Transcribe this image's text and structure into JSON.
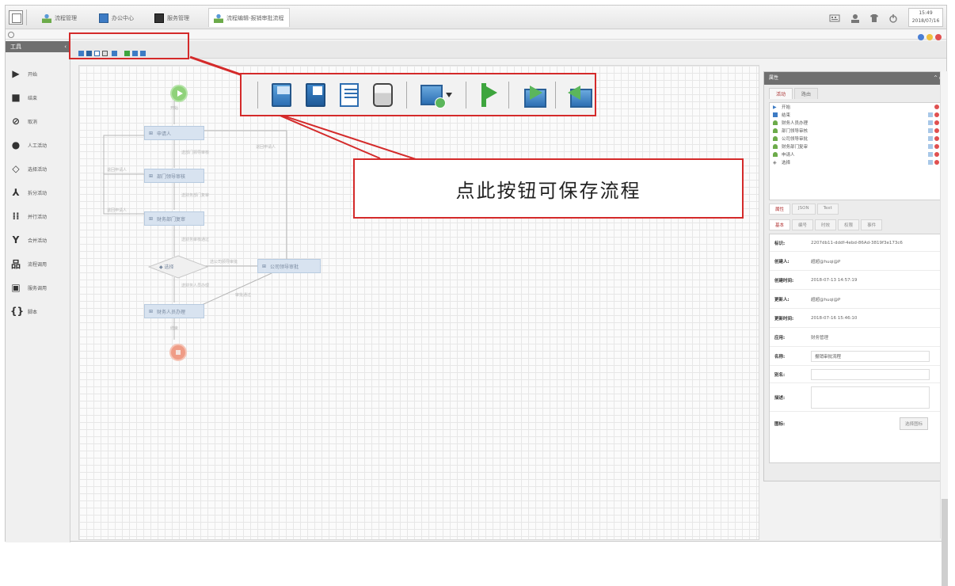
{
  "topbar": {
    "tabs": [
      {
        "label": "流程管理",
        "icon": "user-group-icon"
      },
      {
        "label": "办公中心",
        "icon": "document-icon"
      },
      {
        "label": "服务管理",
        "icon": "monitor-icon"
      },
      {
        "label": "流程编辑-报销审批流程",
        "icon": "user-group-icon"
      }
    ],
    "clock": {
      "time": "15:49",
      "date": "2018/07/16"
    }
  },
  "sidebar": {
    "title": "工具",
    "items": [
      {
        "label": "开始",
        "icon": "play-icon"
      },
      {
        "label": "结束",
        "icon": "stop-icon"
      },
      {
        "label": "取消",
        "icon": "cancel-icon"
      },
      {
        "label": "人工活动",
        "icon": "person-icon"
      },
      {
        "label": "选择活动",
        "icon": "choice-icon"
      },
      {
        "label": "拆分活动",
        "icon": "split-icon"
      },
      {
        "label": "并行活动",
        "icon": "parallel-icon"
      },
      {
        "label": "合并活动",
        "icon": "merge-icon"
      },
      {
        "label": "流程调用",
        "icon": "process-call-icon"
      },
      {
        "label": "服务调用",
        "icon": "service-call-icon"
      },
      {
        "label": "脚本",
        "icon": "script-icon"
      }
    ]
  },
  "flow": {
    "start_label": "开始",
    "end_label": "结束",
    "nodes": [
      "申请人",
      "部门领导审核",
      "财务部门复审",
      "公司领导审批",
      "财务人员办理"
    ],
    "decision": "选择",
    "edge_labels": [
      "送部门领导审核",
      "退回申请人",
      "送财务部门复审",
      "退回申请人",
      "送财务审核通过",
      "退回申请人",
      "选公司领导审批",
      "送财务人员办理",
      "审批通过"
    ]
  },
  "callout": {
    "text": "点此按钮可保存流程"
  },
  "properties": {
    "title": "属性",
    "top_tabs": [
      "活动",
      "路由"
    ],
    "activities": [
      {
        "label": "开始",
        "icon": "play-icon"
      },
      {
        "label": "结束",
        "icon": "stop-icon"
      },
      {
        "label": "财务人员办理",
        "icon": "person-icon"
      },
      {
        "label": "部门领导审核",
        "icon": "person-icon"
      },
      {
        "label": "公司领导审批",
        "icon": "person-icon"
      },
      {
        "label": "财务部门复审",
        "icon": "person-icon"
      },
      {
        "label": "申请人",
        "icon": "person-icon"
      },
      {
        "label": "选择",
        "icon": "choice-icon"
      }
    ],
    "view_tabs": [
      "属性",
      "JSON",
      "Text"
    ],
    "detail_tabs": [
      "基本",
      "编号",
      "时效",
      "权限",
      "事件"
    ],
    "fields": {
      "id_label": "标识:",
      "id_value": "2207db11-dddf-4ebd-86Ad-3819f3e173c6",
      "creator_label": "创建人:",
      "creator_value": "超超@huqi@P",
      "created_label": "创建时间:",
      "created_value": "2018-07-13 14:57:19",
      "updater_label": "更新人:",
      "updater_value": "超超@huqi@P",
      "updated_label": "更新时间:",
      "updated_value": "2018-07-16 15:46:10",
      "app_label": "应用:",
      "app_value": "财务管理",
      "name_label": "名称:",
      "name_value": "报销审批流程",
      "alias_label": "别名:",
      "alias_value": "",
      "desc_label": "描述:",
      "icon_label": "图标:",
      "icon_button": "选择图标"
    }
  },
  "colors": {
    "accent_red": "#d42a2a",
    "start_green": "#8fd27a",
    "end_red": "#ef9c86",
    "node_blue": "#d8e3f0",
    "dot_blue": "#4a7fd4",
    "dot_yellow": "#f0c040",
    "dot_red": "#e05050"
  }
}
